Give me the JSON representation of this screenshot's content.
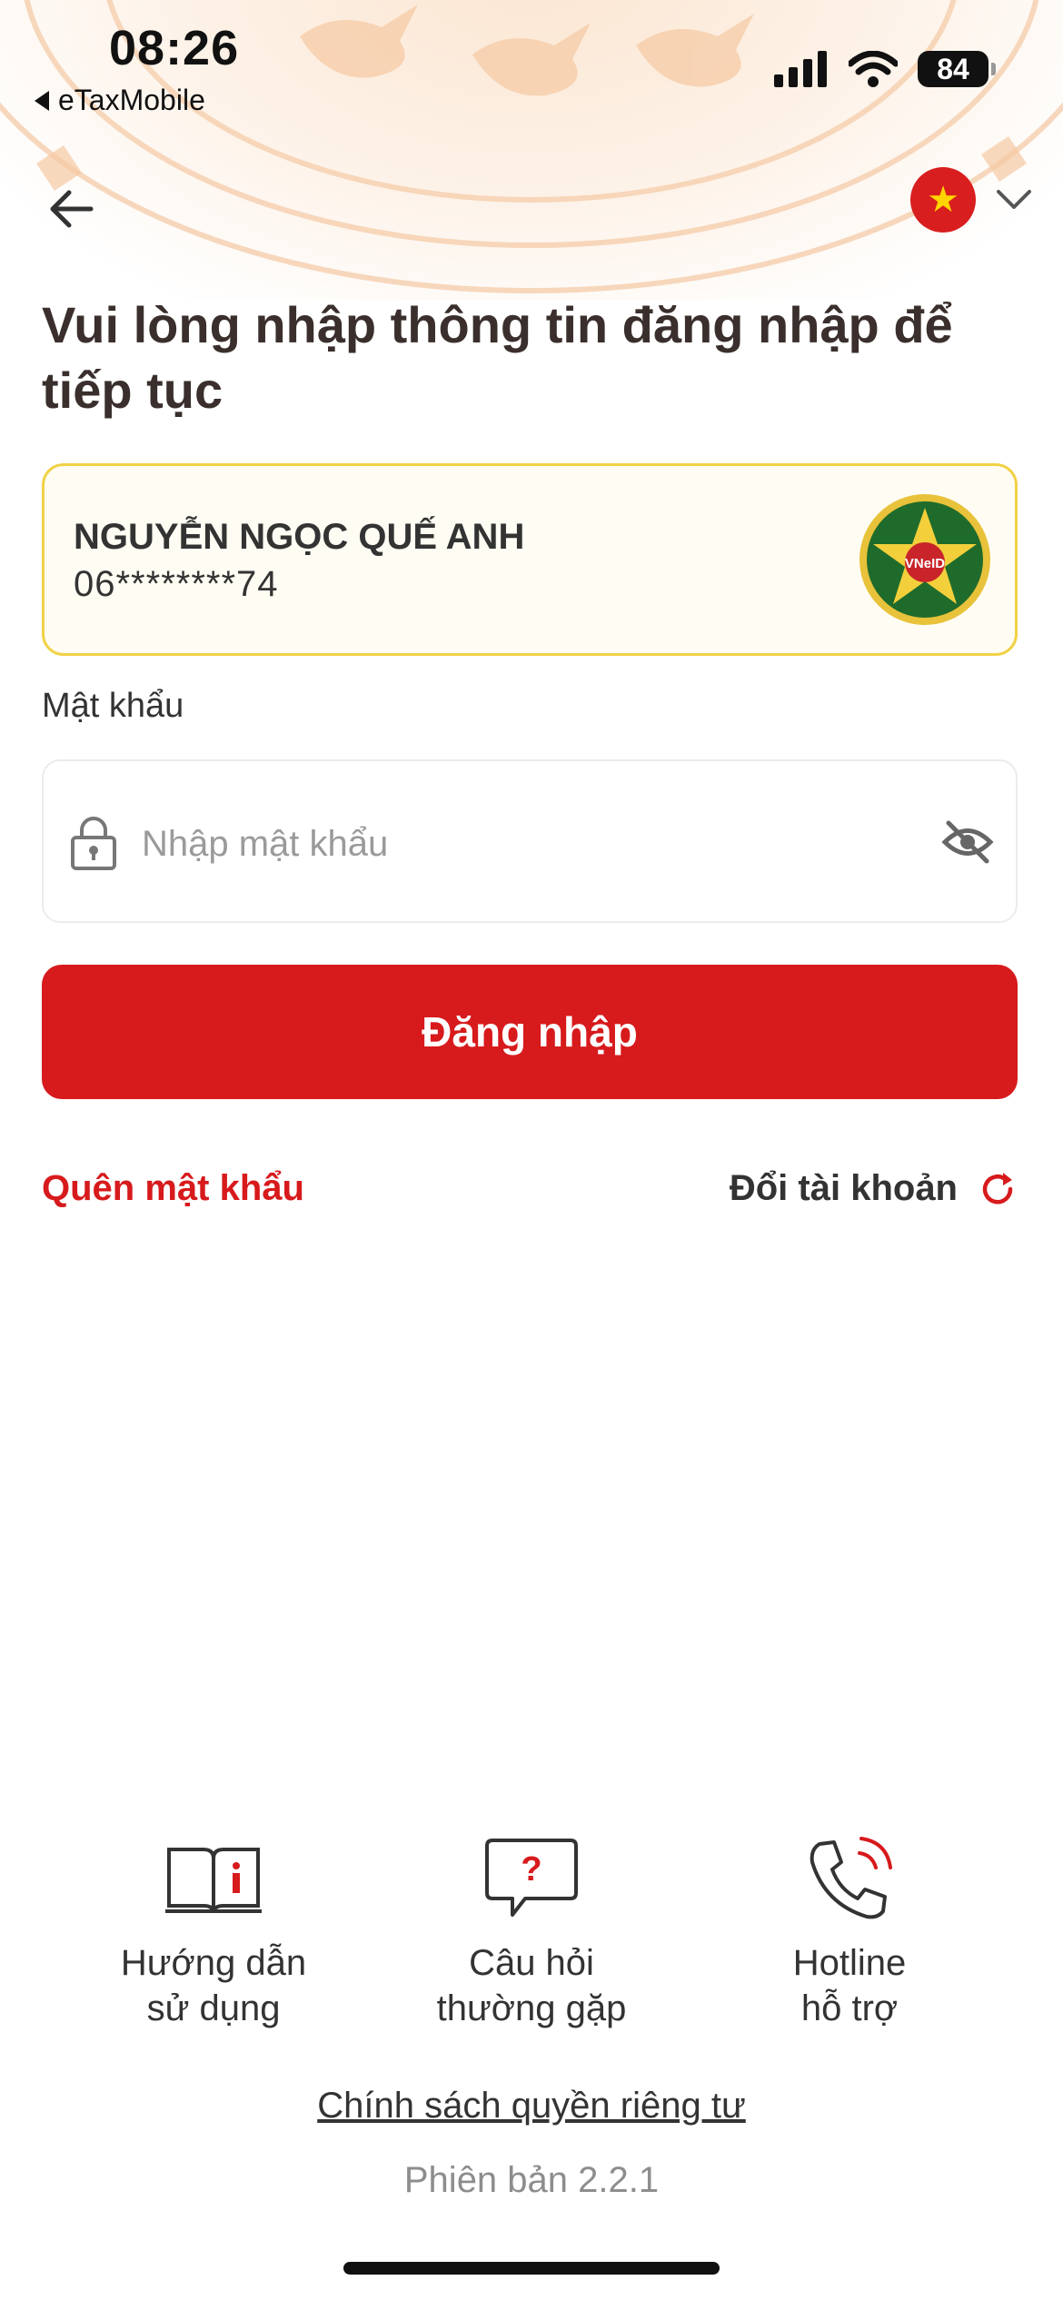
{
  "status_bar": {
    "time": "08:26",
    "back_app_label": "eTaxMobile",
    "battery": "84"
  },
  "title": "Vui lòng nhập thông tin đăng nhập để tiếp tục",
  "account": {
    "name": "NGUYỄN NGỌC QUẾ ANH",
    "id_masked": "06********74",
    "badge_text": "VNeID"
  },
  "password": {
    "label": "Mật khẩu",
    "placeholder": "Nhập mật khẩu",
    "value": ""
  },
  "login_button": "Đăng nhập",
  "links": {
    "forgot_password": "Quên mật khẩu",
    "switch_account": "Đổi tài khoản"
  },
  "footer": {
    "items": [
      {
        "line1": "Hướng dẫn",
        "line2": "sử dụng",
        "icon": "book-icon"
      },
      {
        "line1": "Câu hỏi",
        "line2": "thường gặp",
        "icon": "question-bubble-icon"
      },
      {
        "line1": "Hotline",
        "line2": "hỗ trợ",
        "icon": "phone-icon"
      }
    ],
    "privacy": "Chính sách quyền riêng tư",
    "version": "Phiên bản 2.2.1"
  },
  "colors": {
    "primary_red": "#d71a1c",
    "card_border": "#f1d246",
    "header_tint": "#fbe6d2"
  }
}
